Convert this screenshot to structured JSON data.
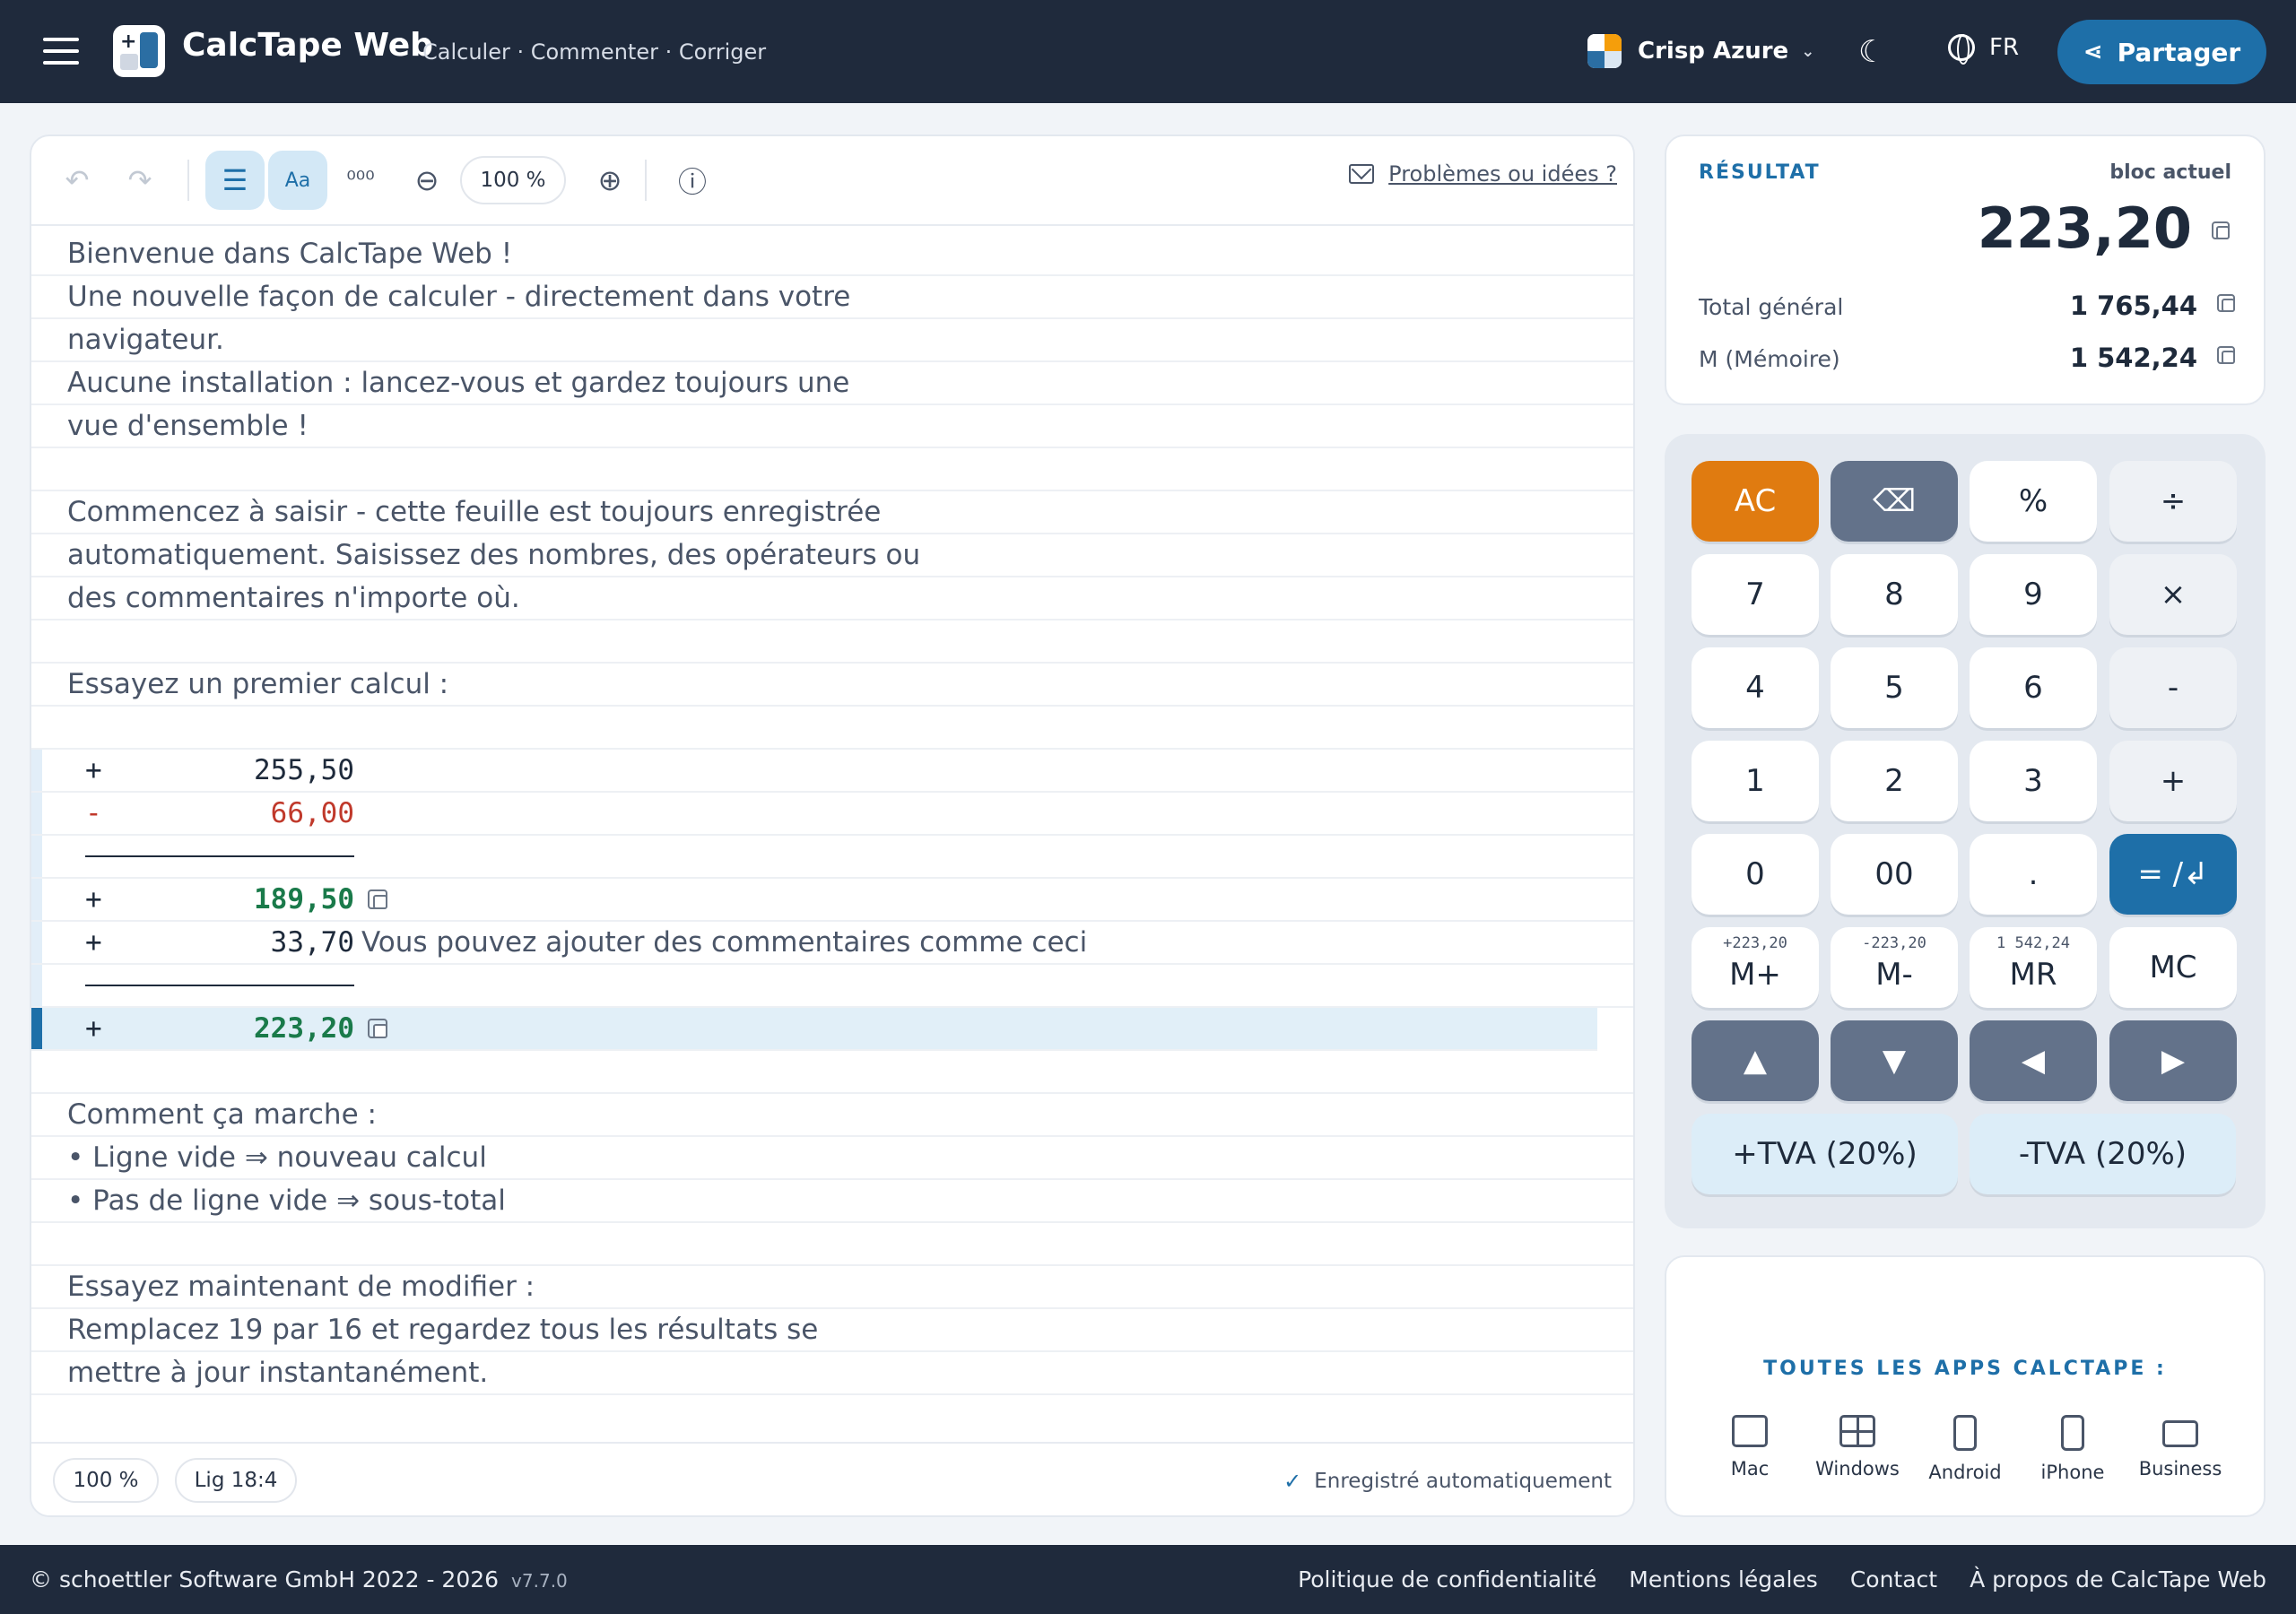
{
  "header": {
    "app_title": "CalcTape Web",
    "tagline": "Calculer · Commenter · Corriger",
    "theme_name": "Crisp Azure",
    "language": "FR",
    "share_label": "Partager"
  },
  "toolbar": {
    "zoom": "100 %",
    "aa_label": "Aa",
    "feedback_label": "Problèmes ou idées ?"
  },
  "document": {
    "lines": [
      "Bienvenue dans CalcTape Web !",
      "Une nouvelle façon de calculer - directement dans votre",
      "navigateur.",
      "Aucune installation : lancez-vous et gardez toujours une",
      "vue d'ensemble !",
      "",
      "Commencez à saisir - cette feuille est toujours enregistrée",
      "automatiquement. Saisissez des nombres, des opérateurs ou",
      "des commentaires n'importe où.",
      "",
      "Essayez un premier calcul :",
      ""
    ],
    "calc": [
      {
        "op": "+",
        "value": "255,50"
      },
      {
        "op": "-",
        "value": "66,00"
      },
      {
        "op": "+",
        "value": "189,50"
      },
      {
        "op": "+",
        "value": "33,70",
        "comment": "Vous pouvez ajouter des commentaires comme ceci"
      },
      {
        "op": "+",
        "value": "223,20"
      }
    ],
    "lines_after": [
      "",
      "Comment ça marche :",
      "• Ligne vide ⇒ nouveau calcul",
      "• Pas de ligne vide ⇒ sous-total",
      "",
      "Essayez maintenant de modifier :",
      "Remplacez 19 par 16 et regardez tous les résultats se",
      "mettre à jour instantanément."
    ]
  },
  "statusbar": {
    "zoom": "100 %",
    "position": "Lig 18:4",
    "saved": "Enregistré automatiquement"
  },
  "result": {
    "label": "RÉSULTAT",
    "block_label": "bloc actuel",
    "value": "223,20",
    "grand_total_label": "Total général",
    "grand_total": "1 765,44",
    "memory_label": "M (Mémoire)",
    "memory": "1 542,24"
  },
  "keypad": {
    "ac": "AC",
    "backspace": "⌫",
    "percent": "%",
    "divide": "÷",
    "k7": "7",
    "k8": "8",
    "k9": "9",
    "multiply": "×",
    "k4": "4",
    "k5": "5",
    "k6": "6",
    "minus": "-",
    "k1": "1",
    "k2": "2",
    "k3": "3",
    "plus": "+",
    "k0": "0",
    "k00": "00",
    "dot": ".",
    "equals": "= /↲",
    "mplus": "M+",
    "mplus_preview": "+223,20",
    "mminus": "M-",
    "mminus_preview": "-223,20",
    "mr": "MR",
    "mr_preview": "1 542,24",
    "mc": "MC",
    "up": "▲",
    "down": "▼",
    "left": "◀",
    "right": "▶",
    "vat_plus": "+TVA (20%)",
    "vat_minus": "-TVA (20%)"
  },
  "apps": {
    "title": "TOUTES LES APPS CALCTAPE :",
    "items": [
      "Mac",
      "Windows",
      "Android",
      "iPhone",
      "Business"
    ]
  },
  "footer": {
    "copyright": "© schoettler Software GmbH 2022 - 2026",
    "version": "v7.7.0",
    "links": [
      "Politique de confidentialité",
      "Mentions légales",
      "Contact",
      "À propos de CalcTape Web"
    ]
  },
  "colors": {
    "header_bg": "#1f2a3c",
    "accent": "#1e6fa8",
    "ac_key": "#e07b10",
    "result_green": "#1a7a4a",
    "minus_red": "#c0392b"
  }
}
